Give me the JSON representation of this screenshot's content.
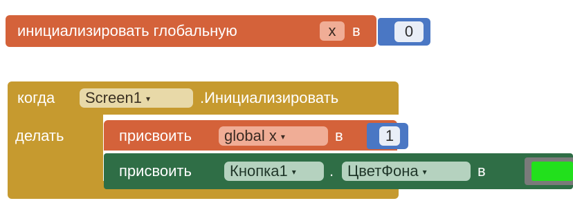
{
  "init_block": {
    "label": "инициализировать глобальную",
    "var_name": "x",
    "to_label": "в",
    "value": "0"
  },
  "event_block": {
    "when_label": "когда",
    "component": "Screen1",
    "event": ".Инициализировать",
    "do_label": "делать"
  },
  "set_global": {
    "label": "присвоить",
    "var": "global x",
    "to_label": "в",
    "value": "1"
  },
  "set_property": {
    "label": "присвоить",
    "component": "Кнопка1",
    "dot": ".",
    "property": "ЦветФона",
    "to_label": "в",
    "color_value": "#22e01c"
  },
  "colors": {
    "variables": "#d4623a",
    "control": "#c69a2f",
    "math": "#4a77c4",
    "components": "#2f6e46"
  }
}
